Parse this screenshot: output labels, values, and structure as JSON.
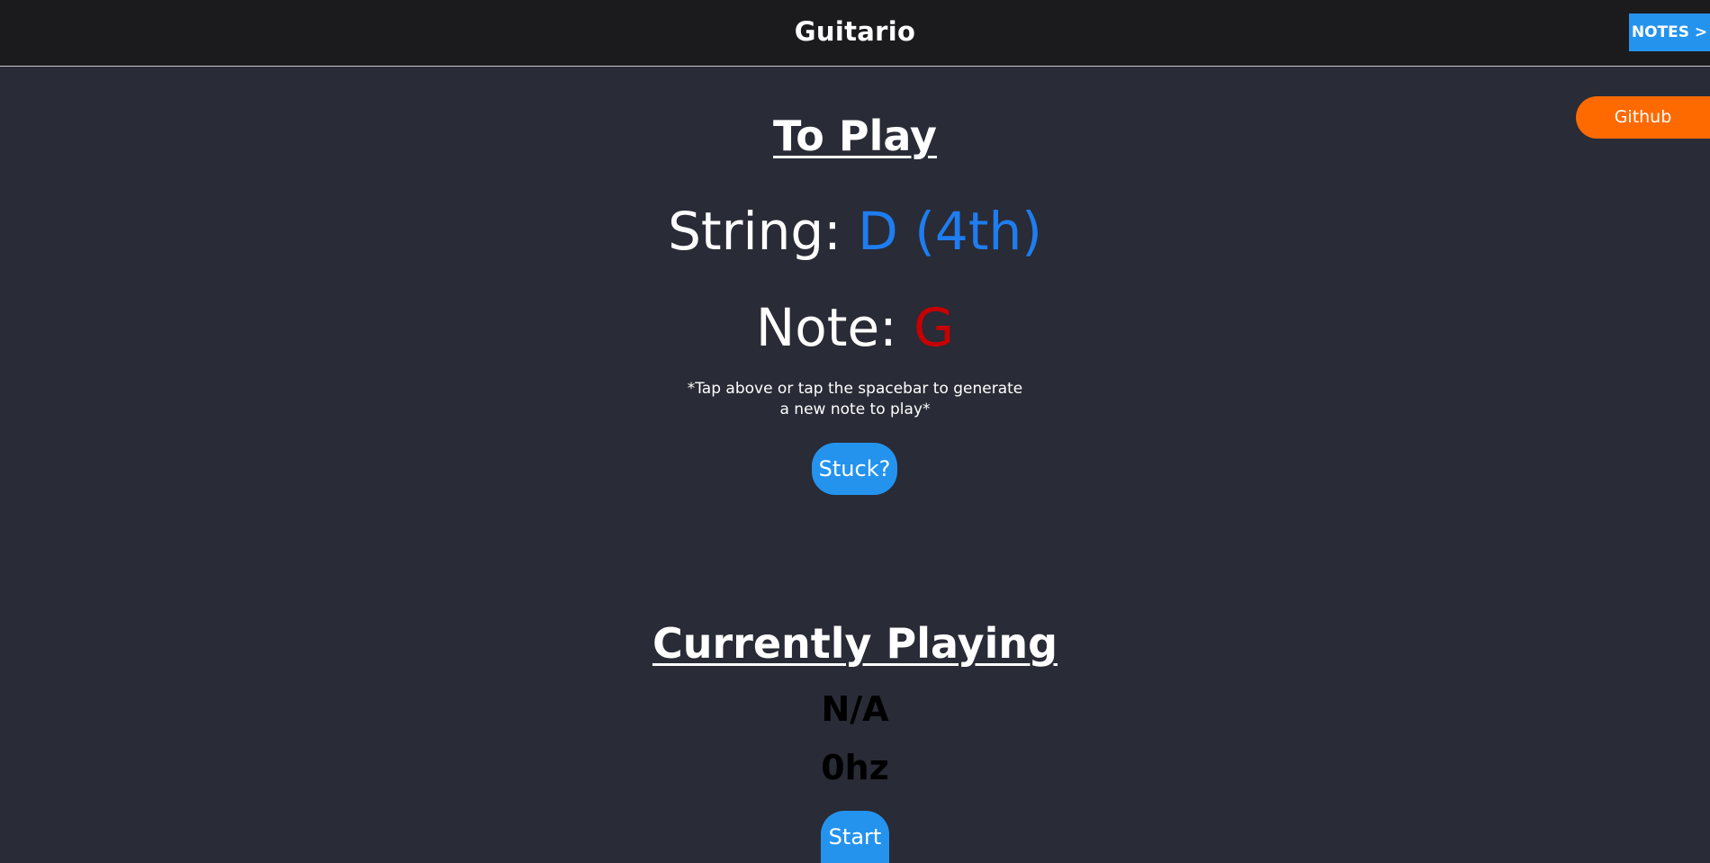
{
  "header": {
    "title": "Guitario",
    "notes_button": "NOTES >"
  },
  "github_button": "Github",
  "to_play": {
    "heading": "To Play",
    "string_label": "String: ",
    "string_value": "D (4th)",
    "note_label": "Note: ",
    "note_value": "G",
    "hint": "*Tap above or tap the spacebar to generate a new note to play*",
    "stuck_button": "Stuck?"
  },
  "currently_playing": {
    "heading": "Currently Playing",
    "note": "N/A",
    "frequency": "0hz",
    "start_button": "Start"
  },
  "colors": {
    "background": "#292b36",
    "header_bg": "#1b1b1d",
    "accent_blue": "#2493ee",
    "string_blue": "#1e7df0",
    "note_red": "#c80000",
    "github_orange": "#ff6a00"
  }
}
